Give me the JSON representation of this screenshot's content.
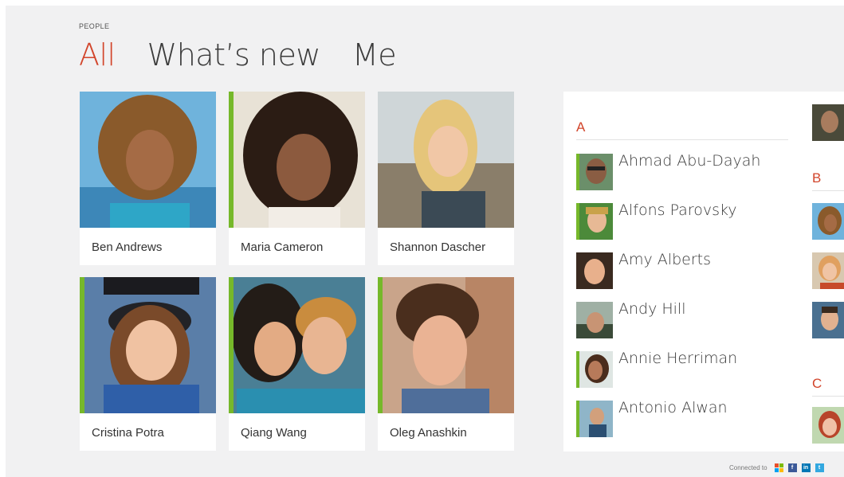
{
  "header": {
    "section_label": "PEOPLE",
    "tabs": [
      {
        "label": "All",
        "active": true
      },
      {
        "label": "What’s new",
        "active": false
      },
      {
        "label": "Me",
        "active": false
      }
    ]
  },
  "favorites": [
    {
      "name": "Ben Andrews",
      "accent": false
    },
    {
      "name": "Maria Cameron",
      "accent": true
    },
    {
      "name": "Shannon Dascher",
      "accent": false
    },
    {
      "name": "Cristina Potra",
      "accent": true
    },
    {
      "name": "Qiang Wang",
      "accent": true
    },
    {
      "name": "Oleg Anashkin",
      "accent": true
    }
  ],
  "contacts": {
    "groups": [
      {
        "letter": "A",
        "items": [
          {
            "name": "Ahmad Abu-Dayah",
            "accent": true
          },
          {
            "name": "Alfons Parovsky",
            "accent": true
          },
          {
            "name": "Amy Alberts",
            "accent": false
          },
          {
            "name": "Andy Hill",
            "accent": false
          },
          {
            "name": "Annie Herriman",
            "accent": true
          },
          {
            "name": "Antonio Alwan",
            "accent": true
          }
        ]
      },
      {
        "letter": "B"
      },
      {
        "letter": "C"
      }
    ]
  },
  "footer": {
    "connected_label": "Connected to",
    "services": [
      "windows-live-icon",
      "facebook-icon",
      "linkedin-icon",
      "twitter-icon"
    ]
  },
  "colors": {
    "accent_red": "#d2452b",
    "accent_green": "#76b82a",
    "background": "#f1f1f2"
  }
}
